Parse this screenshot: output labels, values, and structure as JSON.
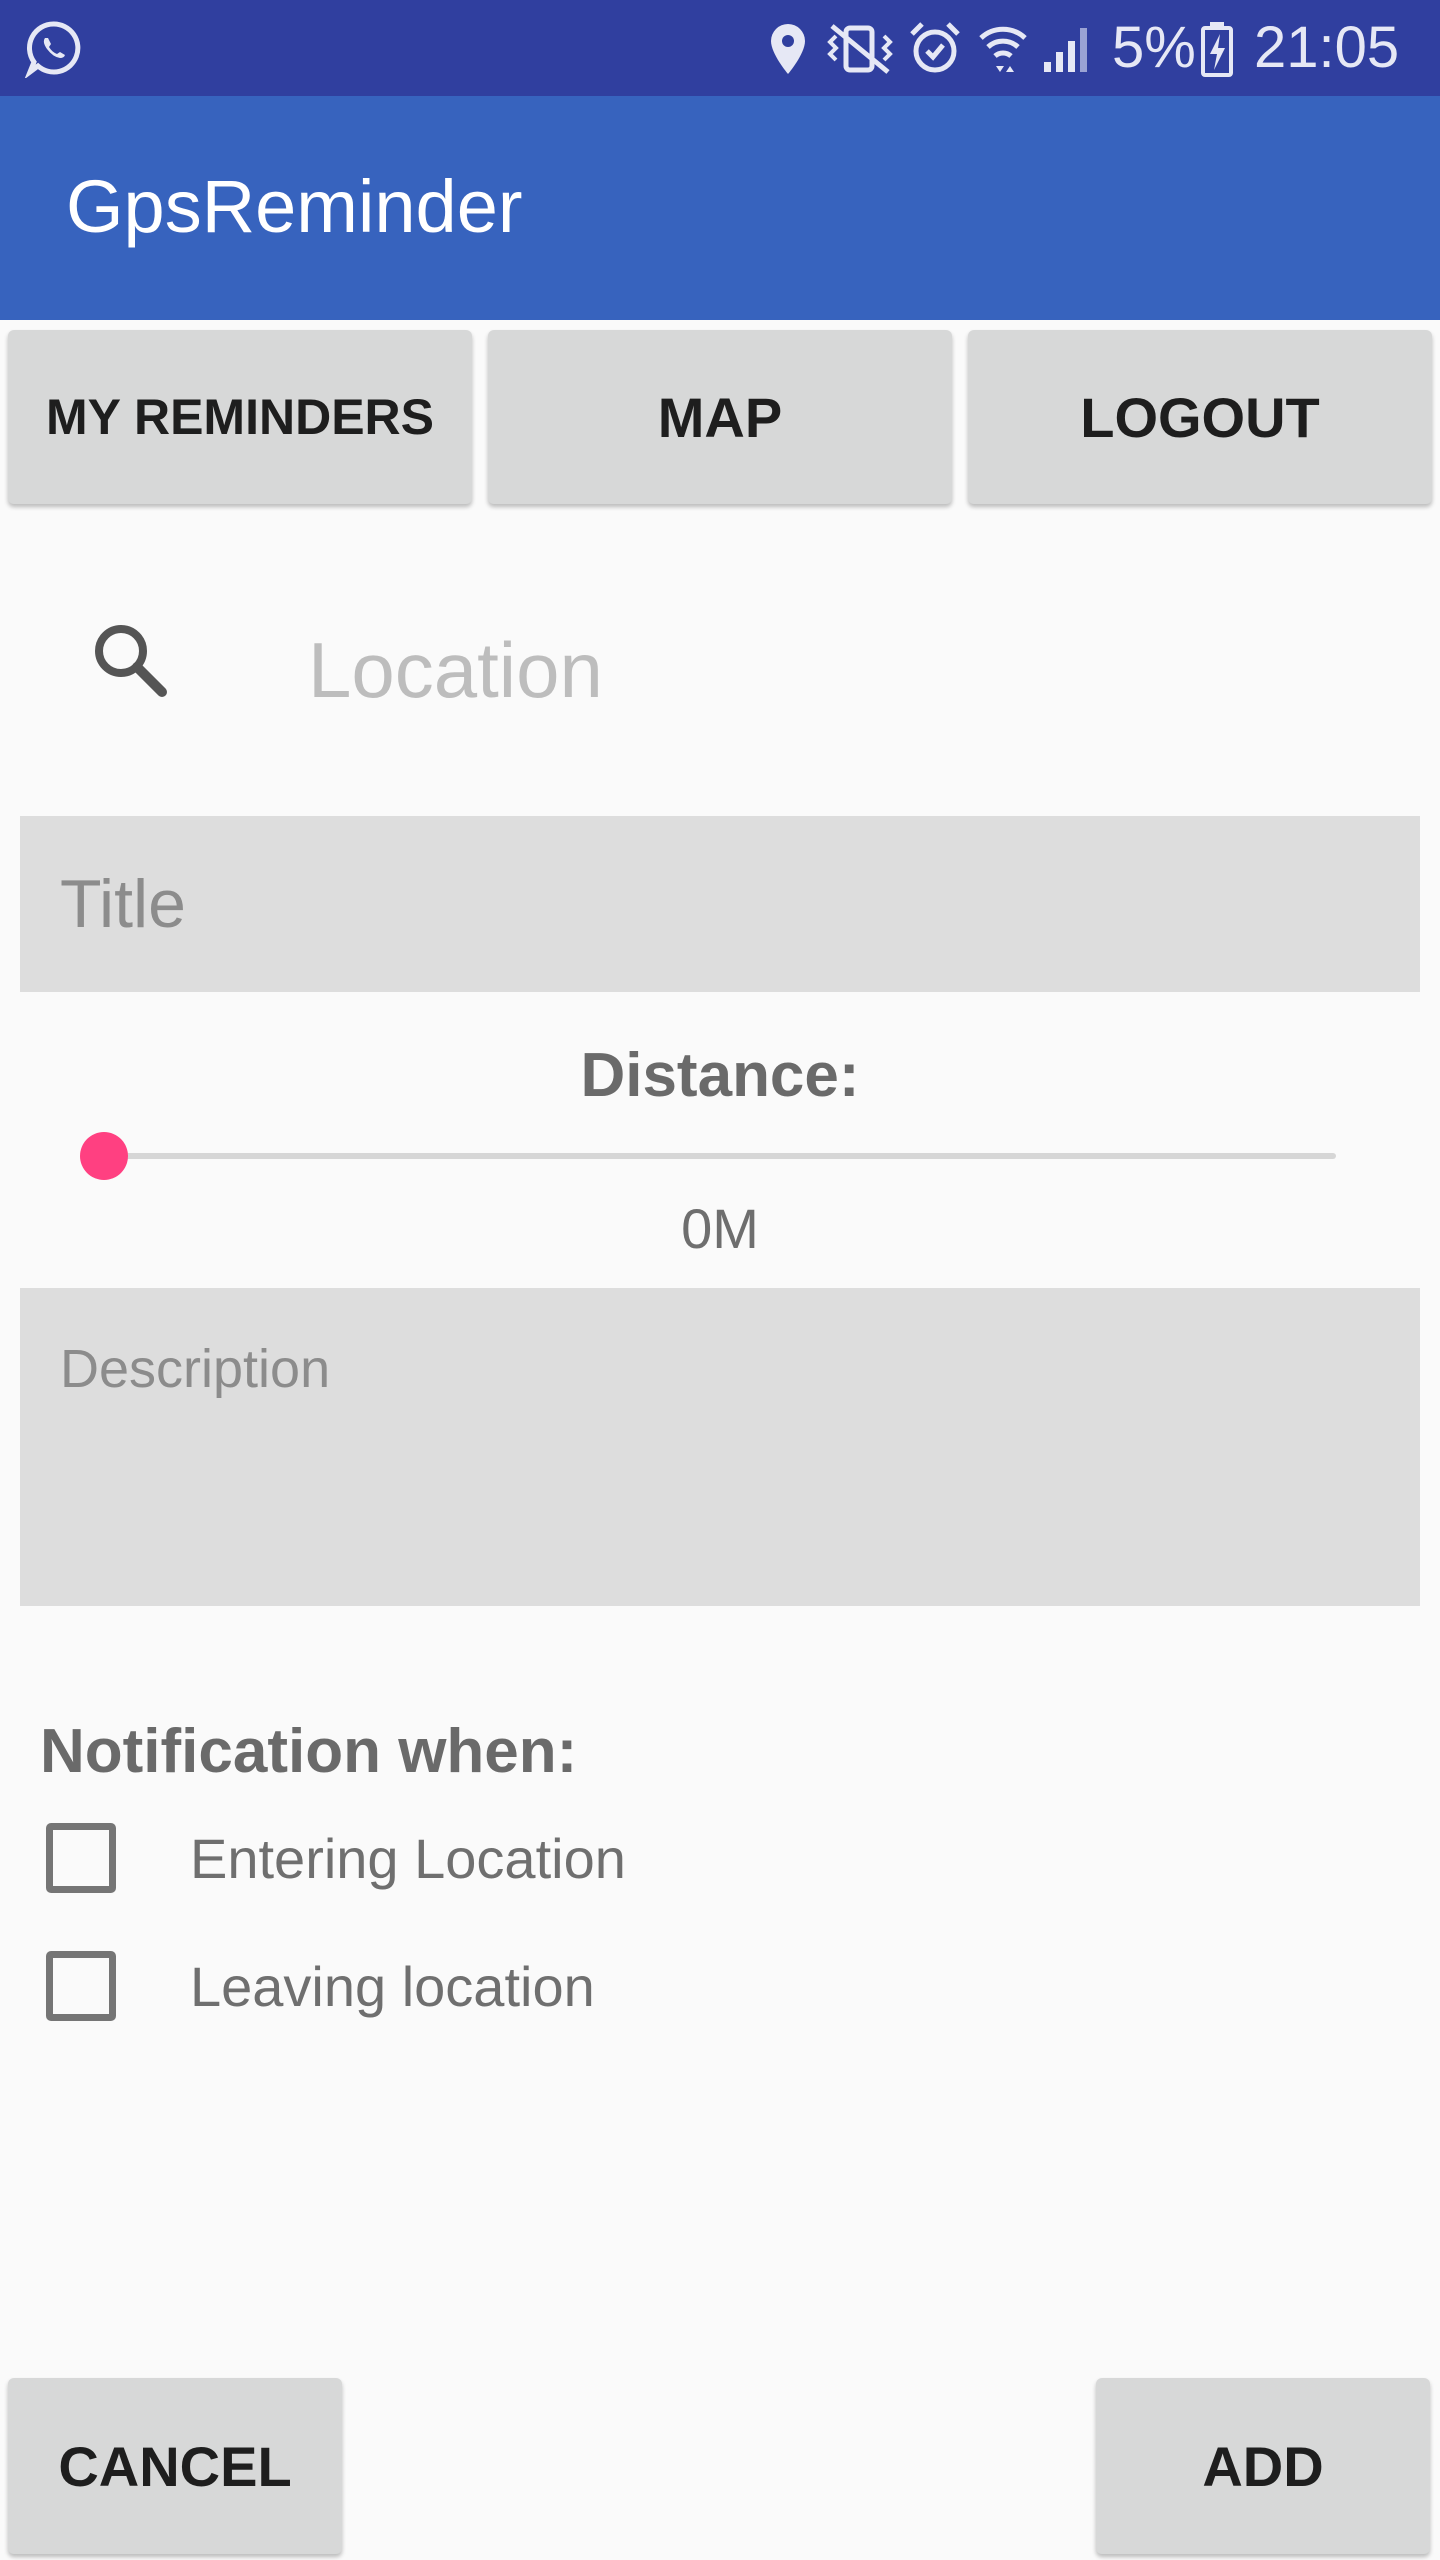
{
  "status_bar": {
    "battery_percent": "5%",
    "time": "21:05",
    "icons": [
      "whatsapp-icon",
      "location-pin-icon",
      "vibrate-mute-icon",
      "alarm-icon",
      "wifi-icon",
      "signal-icon",
      "battery-charging-icon"
    ]
  },
  "app_bar": {
    "title": "GpsReminder",
    "color": "#3763be"
  },
  "nav": {
    "my_reminders_label": "MY REMINDERS",
    "map_label": "MAP",
    "logout_label": "LOGOUT"
  },
  "search": {
    "icon": "search-icon",
    "placeholder": "Location",
    "value": ""
  },
  "form": {
    "title_placeholder": "Title",
    "title_value": "",
    "distance_label": "Distance:",
    "distance_value": 0,
    "distance_display": "0M",
    "description_placeholder": "Description",
    "description_value": ""
  },
  "notification": {
    "heading": "Notification when:",
    "options": [
      {
        "label": "Entering Location",
        "checked": false
      },
      {
        "label": "Leaving location",
        "checked": false
      }
    ]
  },
  "actions": {
    "cancel_label": "CANCEL",
    "add_label": "ADD"
  },
  "colors": {
    "status_bar": "#303f9f",
    "accent": "#ff4081",
    "field_bg": "#dddddd",
    "button_bg": "#d7d8d8"
  }
}
